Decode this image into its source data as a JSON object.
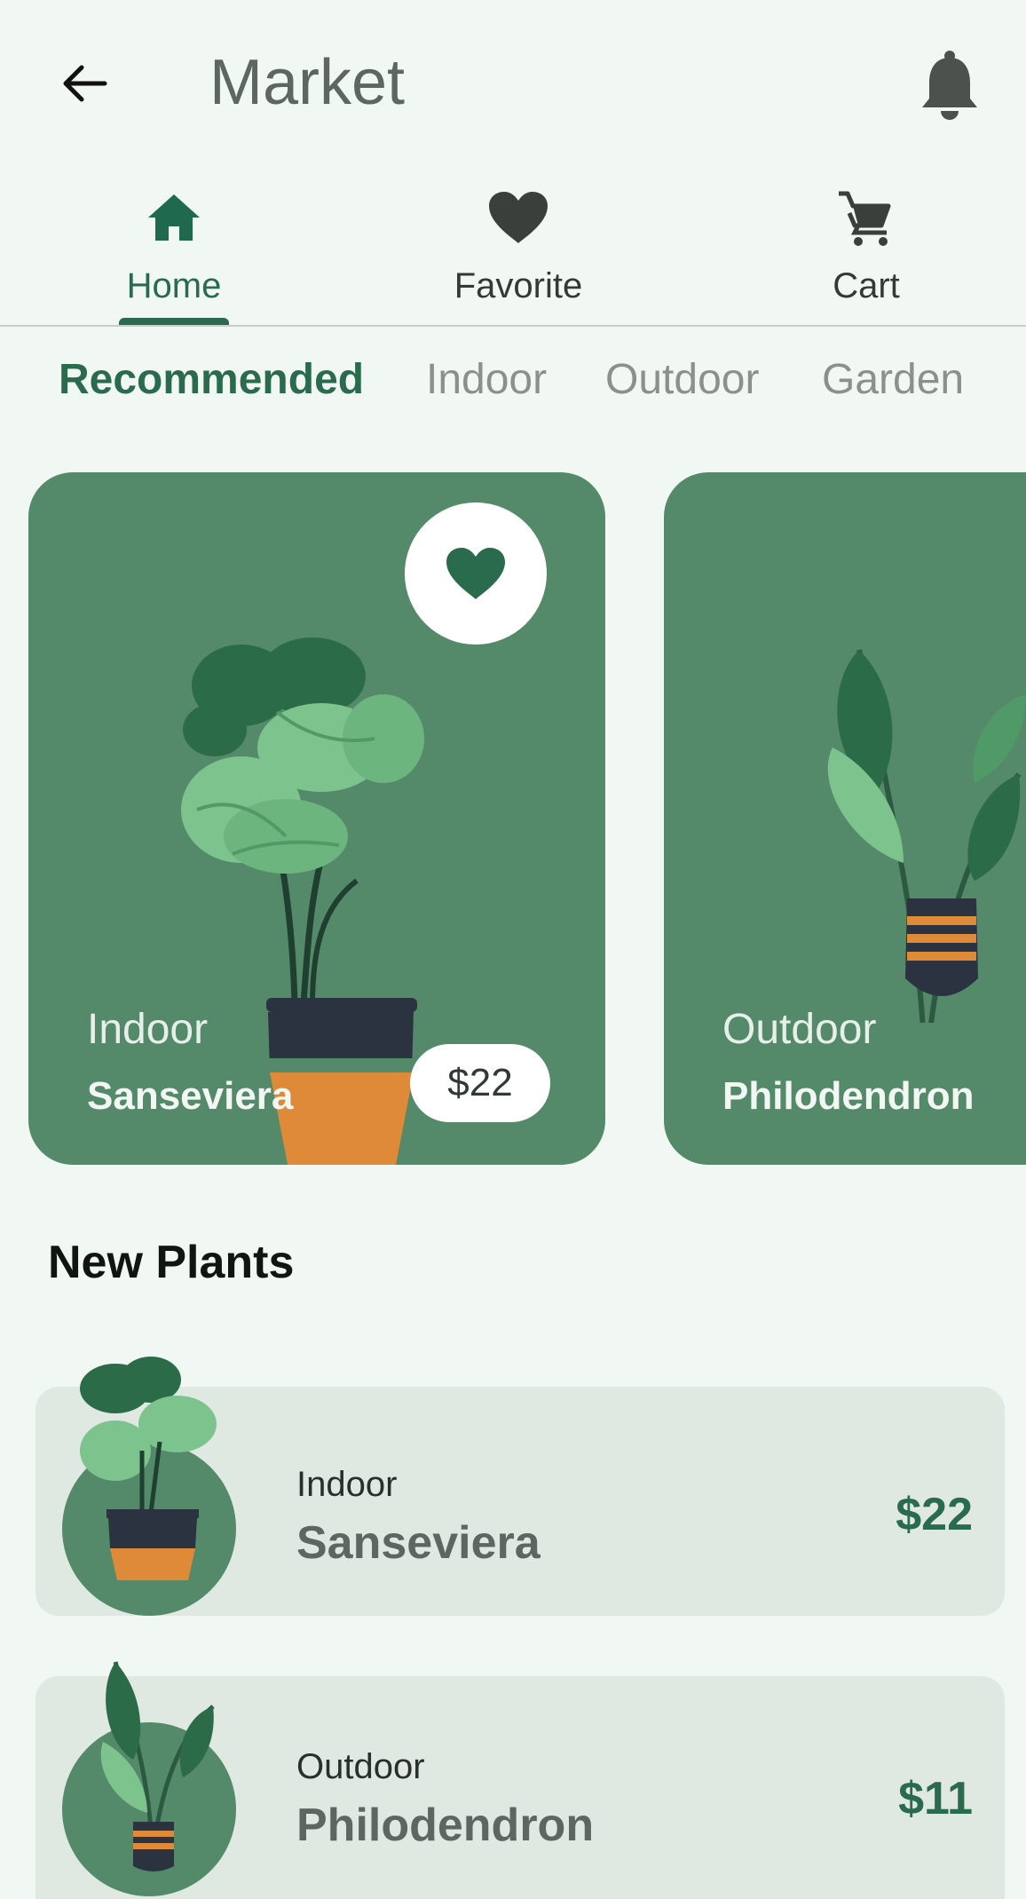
{
  "app_bar": {
    "title": "Market",
    "back_icon": "arrow-left-icon",
    "notification_icon": "bell-icon"
  },
  "tabs": [
    {
      "label": "Home",
      "icon": "home-icon",
      "active": true
    },
    {
      "label": "Favorite",
      "icon": "heart-icon",
      "active": false
    },
    {
      "label": "Cart",
      "icon": "cart-icon",
      "active": false
    }
  ],
  "categories": [
    {
      "label": "Recommended",
      "active": true
    },
    {
      "label": "Indoor",
      "active": false
    },
    {
      "label": "Outdoor",
      "active": false
    },
    {
      "label": "Garden",
      "active": false
    }
  ],
  "featured": [
    {
      "category": "Indoor",
      "name": "Sanseviera",
      "price": "$22",
      "favorite": true
    },
    {
      "category": "Outdoor",
      "name": "Philodendron"
    }
  ],
  "new_plants": {
    "title": "New Plants",
    "items": [
      {
        "category": "Indoor",
        "name": "Sanseviera",
        "price": "$22"
      },
      {
        "category": "Outdoor",
        "name": "Philodendron",
        "price": "$11"
      }
    ]
  },
  "colors": {
    "background": "#f1f7f3",
    "accent": "#2a6b4d",
    "card": "#548a69",
    "list_row": "#dfe9e2",
    "muted_text": "#8a918d"
  }
}
